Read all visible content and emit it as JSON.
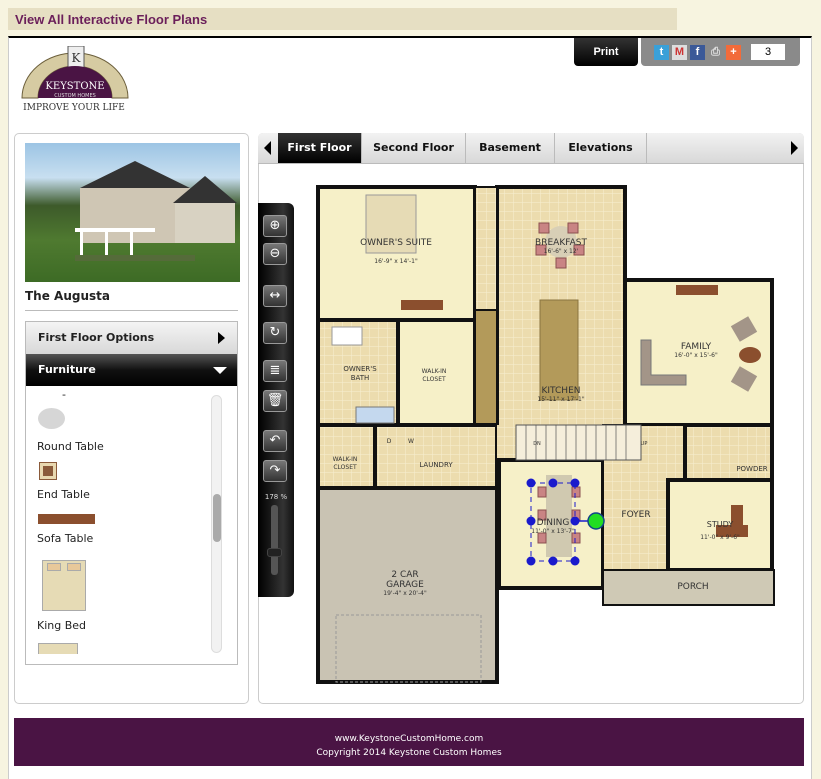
{
  "topbar": {
    "link": "View All Interactive Floor Plans"
  },
  "header": {
    "print_label": "Print",
    "share_count": "3",
    "logo": {
      "brand": "KEYSTONE",
      "sub": "CUSTOM HOMES",
      "tagline": "IMPROVE YOUR LIFE"
    },
    "social_icons": [
      "twitter-icon",
      "gmail-icon",
      "facebook-icon",
      "print-icon",
      "addthis-plus-icon"
    ]
  },
  "sidebar": {
    "home_name": "The Augusta",
    "accordion": [
      {
        "label": "First Floor Options",
        "state": "collapsed"
      },
      {
        "label": "Furniture",
        "state": "expanded"
      }
    ],
    "furniture_items": [
      {
        "label": "-"
      },
      {
        "label": "Round Table"
      },
      {
        "label": "End Table"
      },
      {
        "label": "Sofa Table"
      },
      {
        "label": "King Bed"
      }
    ],
    "scroll_position_percent": 47
  },
  "tabs": [
    {
      "label": "First Floor",
      "active": true
    },
    {
      "label": "Second Floor"
    },
    {
      "label": "Basement"
    },
    {
      "label": "Elevations"
    }
  ],
  "toolbar": {
    "buttons": [
      "zoom-in-icon",
      "zoom-out-icon",
      "fit-width-icon",
      "rotate-icon",
      "notes-icon",
      "delete-icon",
      "undo-icon",
      "redo-icon"
    ],
    "zoom_level": "178 %",
    "zoom_slider_percent": 70
  },
  "plan": {
    "rooms": {
      "owners_suite": {
        "name": "OWNER'S SUITE",
        "dims": "16'-9\" x 14'-1\""
      },
      "breakfast": {
        "name": "BREAKFAST",
        "dims": "16'-6\" x 12'"
      },
      "family": {
        "name": "FAMILY",
        "dims": "16'-0\" x 15'-6\""
      },
      "owners_bath": {
        "name": "OWNER'S",
        "name2": "BATH"
      },
      "walkin1": {
        "name": "WALK-IN",
        "name2": "CLOSET"
      },
      "kitchen": {
        "name": "KITCHEN",
        "dims": "15'-11\" x 17'-1\""
      },
      "walkin2": {
        "name": "WALK-IN",
        "name2": "CLOSET"
      },
      "laundry": {
        "name": "LAUNDRY",
        "d": "D",
        "w": "W"
      },
      "garage": {
        "name": "2 CAR",
        "name2": "GARAGE",
        "dims": "19'-4\" x 20'-4\""
      },
      "dining": {
        "name": "DINING",
        "dims": "11'-0\" x 13'-7\""
      },
      "foyer": {
        "name": "FOYER"
      },
      "powder": {
        "name": "POWDER"
      },
      "study": {
        "name": "STUDY",
        "dims": "11'-0\" x 9'-6\""
      },
      "porch": {
        "name": "PORCH"
      },
      "stairs": {
        "dn": "DN",
        "up": "UP"
      }
    }
  },
  "footer": {
    "url": "www.KeystoneCustomHome.com",
    "copyright": "Copyright 2014 Keystone Custom Homes"
  },
  "colors": {
    "purple": "#4a1444",
    "link": "#6b1f5a",
    "selection_handle": "#1a1acc",
    "rotate_handle": "#22dd22"
  }
}
